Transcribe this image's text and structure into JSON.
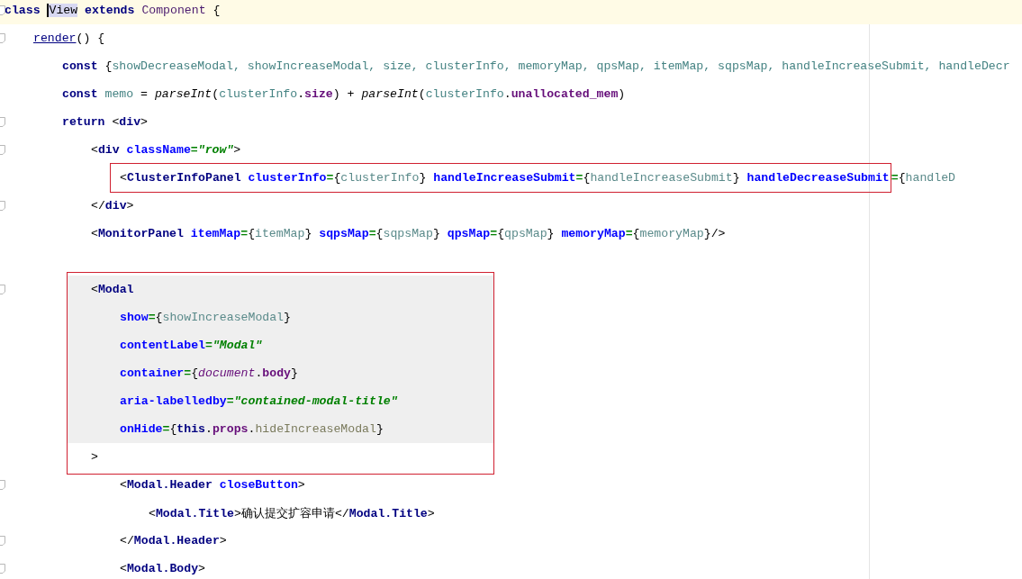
{
  "editor": {
    "lines": [
      {
        "fold": true,
        "shaded": false,
        "tokens": [
          {
            "kind": "kw",
            "text": "class "
          },
          {
            "kind": "cursor",
            "text": "View"
          },
          {
            "kind": "kw",
            "text": " extends "
          },
          {
            "kind": "cls",
            "text": "Component"
          },
          {
            "kind": "p",
            "text": " {"
          }
        ],
        "children": [
          {
            "fold": true,
            "shaded": false,
            "tokens": [
              {
                "kind": "method",
                "text": "render"
              },
              {
                "kind": "p",
                "text": "() {"
              }
            ],
            "children": [
              {
                "fold": false,
                "shaded": false,
                "tokens": [
                  {
                    "kind": "kw",
                    "text": "const "
                  },
                  {
                    "kind": "p",
                    "text": "{"
                  },
                  {
                    "kind": "local",
                    "text": "showDecreaseModal, showIncreaseModal, size, clusterInfo, memoryMap, qpsMap, itemMap, sqpsMap, handleIncreaseSubmit, handleDecr"
                  }
                ]
              },
              {
                "fold": false,
                "shaded": false,
                "tokens": [
                  {
                    "kind": "kw",
                    "text": "const "
                  },
                  {
                    "kind": "local",
                    "text": "memo"
                  },
                  {
                    "kind": "p",
                    "text": " = "
                  },
                  {
                    "kind": "fn",
                    "text": "parseInt"
                  },
                  {
                    "kind": "p",
                    "text": "("
                  },
                  {
                    "kind": "local",
                    "text": "clusterInfo"
                  },
                  {
                    "kind": "p",
                    "text": "."
                  },
                  {
                    "kind": "field",
                    "text": "size"
                  },
                  {
                    "kind": "p",
                    "text": ") + "
                  },
                  {
                    "kind": "fn",
                    "text": "parseInt"
                  },
                  {
                    "kind": "p",
                    "text": "("
                  },
                  {
                    "kind": "local",
                    "text": "clusterInfo"
                  },
                  {
                    "kind": "p",
                    "text": "."
                  },
                  {
                    "kind": "field",
                    "text": "unallocated_mem"
                  },
                  {
                    "kind": "p",
                    "text": ")"
                  }
                ]
              },
              {
                "fold": true,
                "shaded": false,
                "tokens": [
                  {
                    "kind": "kw",
                    "text": "return "
                  },
                  {
                    "kind": "p",
                    "text": "<"
                  },
                  {
                    "kind": "tag",
                    "text": "div"
                  },
                  {
                    "kind": "p",
                    "text": ">"
                  }
                ],
                "children": [
                  {
                    "fold": true,
                    "shaded": false,
                    "tokens": [
                      {
                        "kind": "p",
                        "text": "<"
                      },
                      {
                        "kind": "tag",
                        "text": "div"
                      },
                      {
                        "kind": "attr",
                        "text": " className"
                      },
                      {
                        "kind": "eq",
                        "text": "="
                      },
                      {
                        "kind": "str",
                        "text": "\"row\""
                      },
                      {
                        "kind": "p",
                        "text": ">"
                      }
                    ],
                    "children": [
                      {
                        "fold": false,
                        "shaded": false,
                        "frame": [
                          {
                            "kind": "p",
                            "text": "<"
                          },
                          {
                            "kind": "tag",
                            "text": "ClusterInfoPanel"
                          },
                          {
                            "kind": "attr",
                            "text": " clusterInfo"
                          },
                          {
                            "kind": "eq",
                            "text": "="
                          },
                          {
                            "kind": "p",
                            "text": "{"
                          },
                          {
                            "kind": "expr",
                            "text": "clusterInfo"
                          },
                          {
                            "kind": "p",
                            "text": "} "
                          },
                          {
                            "kind": "attr",
                            "text": "handleIncreaseSubmit"
                          },
                          {
                            "kind": "eq",
                            "text": "="
                          },
                          {
                            "kind": "p",
                            "text": "{"
                          },
                          {
                            "kind": "expr",
                            "text": "handleIncreaseSubmit"
                          },
                          {
                            "kind": "p",
                            "text": "} "
                          },
                          {
                            "kind": "attr",
                            "text": "handleDecreaseSubmit"
                          }
                        ],
                        "tokens": [
                          {
                            "kind": "eq",
                            "text": "="
                          },
                          {
                            "kind": "p",
                            "text": "{"
                          },
                          {
                            "kind": "expr",
                            "text": "handleD"
                          }
                        ]
                      }
                    ]
                  },
                  {
                    "fold": true,
                    "shaded": false,
                    "tokens": [
                      {
                        "kind": "p",
                        "text": "</"
                      },
                      {
                        "kind": "tag",
                        "text": "div"
                      },
                      {
                        "kind": "p",
                        "text": ">"
                      }
                    ]
                  },
                  {
                    "fold": false,
                    "shaded": false,
                    "tokens": [
                      {
                        "kind": "p",
                        "text": "<"
                      },
                      {
                        "kind": "tag",
                        "text": "MonitorPanel"
                      },
                      {
                        "kind": "attr",
                        "text": " itemMap"
                      },
                      {
                        "kind": "eq",
                        "text": "="
                      },
                      {
                        "kind": "p",
                        "text": "{"
                      },
                      {
                        "kind": "expr",
                        "text": "itemMap"
                      },
                      {
                        "kind": "p",
                        "text": "} "
                      },
                      {
                        "kind": "attr",
                        "text": "sqpsMap"
                      },
                      {
                        "kind": "eq",
                        "text": "="
                      },
                      {
                        "kind": "p",
                        "text": "{"
                      },
                      {
                        "kind": "expr",
                        "text": "sqpsMap"
                      },
                      {
                        "kind": "p",
                        "text": "} "
                      },
                      {
                        "kind": "attr",
                        "text": "qpsMap"
                      },
                      {
                        "kind": "eq",
                        "text": "="
                      },
                      {
                        "kind": "p",
                        "text": "{"
                      },
                      {
                        "kind": "expr",
                        "text": "qpsMap"
                      },
                      {
                        "kind": "p",
                        "text": "} "
                      },
                      {
                        "kind": "attr",
                        "text": "memoryMap"
                      },
                      {
                        "kind": "eq",
                        "text": "="
                      },
                      {
                        "kind": "p",
                        "text": "{"
                      },
                      {
                        "kind": "expr",
                        "text": "memoryMap"
                      },
                      {
                        "kind": "p",
                        "text": "}/>"
                      }
                    ]
                  },
                  {
                    "kind": "blank"
                  },
                  {
                    "kind": "frame",
                    "lines": [
                      {
                        "fold": true,
                        "shaded": true,
                        "tokens": [
                          {
                            "kind": "p",
                            "text": "<"
                          },
                          {
                            "kind": "tag",
                            "text": "Modal"
                          }
                        ],
                        "children": [
                          {
                            "fold": false,
                            "shaded": true,
                            "tokens": [
                              {
                                "kind": "attr",
                                "text": "show"
                              },
                              {
                                "kind": "eq",
                                "text": "="
                              },
                              {
                                "kind": "p",
                                "text": "{"
                              },
                              {
                                "kind": "expr",
                                "text": "showIncreaseModal"
                              },
                              {
                                "kind": "p",
                                "text": "}"
                              }
                            ]
                          },
                          {
                            "fold": false,
                            "shaded": true,
                            "tokens": [
                              {
                                "kind": "attr",
                                "text": "contentLabel"
                              },
                              {
                                "kind": "eq",
                                "text": "="
                              },
                              {
                                "kind": "str",
                                "text": "\"Modal\""
                              }
                            ]
                          },
                          {
                            "fold": false,
                            "shaded": true,
                            "tokens": [
                              {
                                "kind": "attr",
                                "text": "container"
                              },
                              {
                                "kind": "eq",
                                "text": "="
                              },
                              {
                                "kind": "p",
                                "text": "{"
                              },
                              {
                                "kind": "glob",
                                "text": "document"
                              },
                              {
                                "kind": "p",
                                "text": "."
                              },
                              {
                                "kind": "field",
                                "text": "body"
                              },
                              {
                                "kind": "p",
                                "text": "}"
                              }
                            ]
                          },
                          {
                            "fold": false,
                            "shaded": true,
                            "tokens": [
                              {
                                "kind": "attr",
                                "text": "aria-labelledby"
                              },
                              {
                                "kind": "eq",
                                "text": "="
                              },
                              {
                                "kind": "str",
                                "text": "\"contained-modal-title\""
                              }
                            ]
                          },
                          {
                            "fold": false,
                            "shaded": true,
                            "tokens": [
                              {
                                "kind": "attr",
                                "text": "onHide"
                              },
                              {
                                "kind": "eq",
                                "text": "="
                              },
                              {
                                "kind": "p",
                                "text": "{"
                              },
                              {
                                "kind": "kw",
                                "text": "this"
                              },
                              {
                                "kind": "p",
                                "text": "."
                              },
                              {
                                "kind": "field",
                                "text": "props"
                              },
                              {
                                "kind": "p",
                                "text": "."
                              },
                              {
                                "kind": "prop",
                                "text": "hideIncreaseModal"
                              },
                              {
                                "kind": "p",
                                "text": "}"
                              }
                            ]
                          }
                        ]
                      },
                      {
                        "fold": false,
                        "shaded": false,
                        "tokens": [
                          {
                            "kind": "p",
                            "text": ">"
                          }
                        ]
                      }
                    ],
                    "children": [
                      {
                        "fold": true,
                        "shaded": false,
                        "tokens": [
                          {
                            "kind": "p",
                            "text": "<"
                          },
                          {
                            "kind": "tag",
                            "text": "Modal.Header"
                          },
                          {
                            "kind": "attr",
                            "text": " closeButton"
                          },
                          {
                            "kind": "p",
                            "text": ">"
                          }
                        ],
                        "children": [
                          {
                            "fold": false,
                            "shaded": false,
                            "tokens": [
                              {
                                "kind": "p",
                                "text": "<"
                              },
                              {
                                "kind": "tag",
                                "text": "Modal.Title"
                              },
                              {
                                "kind": "p",
                                "text": ">"
                              },
                              {
                                "kind": "text",
                                "text": "确认提交扩容申请"
                              },
                              {
                                "kind": "p",
                                "text": "</"
                              },
                              {
                                "kind": "tag",
                                "text": "Modal.Title"
                              },
                              {
                                "kind": "p",
                                "text": ">"
                              }
                            ]
                          }
                        ]
                      },
                      {
                        "fold": true,
                        "shaded": false,
                        "tokens": [
                          {
                            "kind": "p",
                            "text": "</"
                          },
                          {
                            "kind": "tag",
                            "text": "Modal.Header"
                          },
                          {
                            "kind": "p",
                            "text": ">"
                          }
                        ]
                      },
                      {
                        "fold": true,
                        "shaded": false,
                        "tokens": [
                          {
                            "kind": "p",
                            "text": "<"
                          },
                          {
                            "kind": "tag",
                            "text": "Modal.Body"
                          },
                          {
                            "kind": "p",
                            "text": ">"
                          }
                        ]
                      }
                    ]
                  }
                ]
              }
            ]
          }
        ]
      }
    ]
  }
}
